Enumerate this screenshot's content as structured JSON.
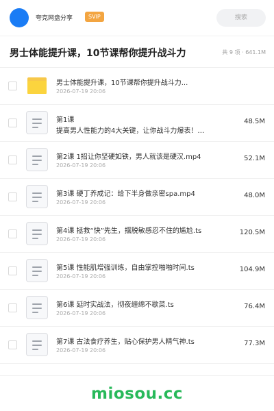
{
  "header": {
    "share_name": "夸克网盘分享",
    "badge": "SVIP",
    "search_placeholder": "搜索",
    "avatar_color": "#1a7cf5",
    "badge_color": "#f3a541"
  },
  "page": {
    "title": "男士体能提升课，10节课帮你提升战斗力",
    "summary": "共 9 项 · 641.1M"
  },
  "files": [
    {
      "type": "folder",
      "name": "男士体能提升课，10节课帮你提升战斗力...",
      "date": "2026-07-19 20:06",
      "size": ""
    },
    {
      "type": "file",
      "name": "第1课",
      "name2": "提高男人性能力的4大关键，让你战斗力爆表！…",
      "date": "",
      "size": "48.5M"
    },
    {
      "type": "file",
      "name": "第2课 1招让你坚硬如铁，男人就该是硬汉.mp4",
      "date": "2026-07-19 20:06",
      "size": "52.1M"
    },
    {
      "type": "file",
      "name": "第3课 硬丁养成记：给下半身做亲密spa.mp4",
      "date": "2026-07-19 20:06",
      "size": "48.0M"
    },
    {
      "type": "file",
      "name": "第4课 拯救“快”先生，摆脱敏感忍不住的尴尬.ts",
      "date": "2026-07-19 20:06",
      "size": "120.5M"
    },
    {
      "type": "file",
      "name": "第5课 性能肌增强训练，自由掌控啪啪时间.ts",
      "date": "2026-07-19 20:06",
      "size": "104.9M"
    },
    {
      "type": "file",
      "name": "第6课 延时实战法，彻夜缠绵不歇菜.ts",
      "date": "2026-07-19 20:06",
      "size": "76.4M"
    },
    {
      "type": "file",
      "name": "第7课 古法食疗养生，贴心保护男人精气神.ts",
      "date": "2026-07-19 20:06",
      "size": "77.3M"
    }
  ],
  "watermark": "miosou.cc",
  "watermark_color": "#28b95a"
}
